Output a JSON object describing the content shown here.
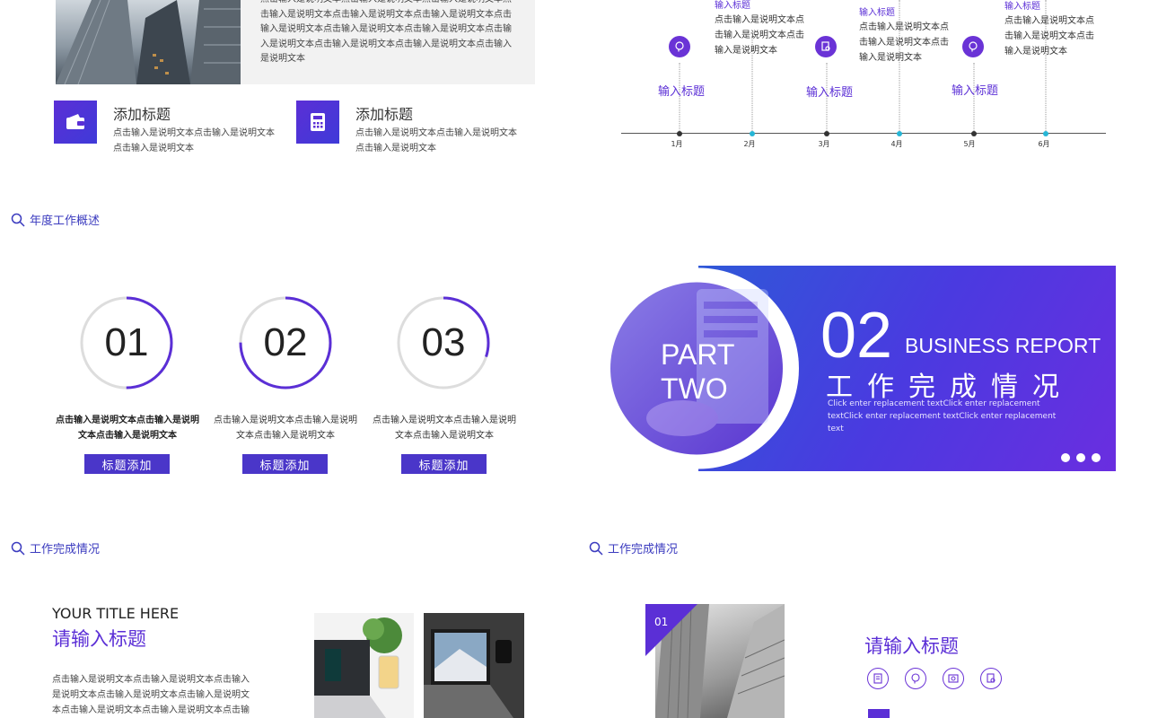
{
  "colors": {
    "accent": "#5b2fd6",
    "ring_track": "#dddddd",
    "banner_start": "#2f58d8",
    "banner_end": "#6a2ee0"
  },
  "slide1": {
    "paragraph": "点击输入是说明文本点击输入是说明文本点击输入是说明文本点击输入是说明文本点击输入是说明文本点击输入是说明文本点击输入是说明文本点击输入是说明文本点击输入是说明文本点击输入是说明文本点击输入是说明文本点击输入是说明文本点击输入是说明文本",
    "features": [
      {
        "title": "添加标题",
        "desc": "点击输入是说明文本点击输入是说明文本点击输入是说明文本",
        "icon": "wallet-icon"
      },
      {
        "title": "添加标题",
        "desc": "点击输入是说明文本点击输入是说明文本点击输入是说明文本",
        "icon": "calculator-icon"
      }
    ]
  },
  "timeline": {
    "months": [
      "1月",
      "2月",
      "3月",
      "4月",
      "5月",
      "6月"
    ],
    "labels": [
      "输入标题",
      "输入标题",
      "输入标题"
    ],
    "infos": [
      {
        "title": "输入标题",
        "desc": "点击输入是说明文本点击输入是说明文本点击输入是说明文本"
      },
      {
        "title": "输入标题",
        "desc": "点击输入是说明文本点击输入是说明文本点击输入是说明文本"
      },
      {
        "title": "输入标题",
        "desc": "点击输入是说明文本点击输入是说明文本点击输入是说明文本"
      }
    ],
    "icons": [
      "head-icon",
      "document-search-icon",
      "head-icon"
    ]
  },
  "sections": {
    "annual": "年度工作概述",
    "done_left": "工作完成情况",
    "done_right": "工作完成情况"
  },
  "rings": [
    {
      "num": "01",
      "text": "点击输入是说明文本点击输入是说明文本点击输入是说明文本",
      "button": "标题添加",
      "progress": 0.5
    },
    {
      "num": "02",
      "text": "点击输入是说明文本点击输入是说明文本点击输入是说明文本",
      "button": "标题添加",
      "progress": 0.75
    },
    {
      "num": "03",
      "text": "点击输入是说明文本点击输入是说明文本点击输入是说明文本",
      "button": "标题添加",
      "progress": 0.3
    }
  ],
  "banner": {
    "part_line1": "PART",
    "part_line2": "TWO",
    "number": "02",
    "eng": "BUSINESS REPORT",
    "cn": "工作完成情况",
    "desc": "Click enter replacement textClick enter replacement textClick enter replacement textClick enter replacement text"
  },
  "slide5": {
    "title_en": "YOUR TITLE HERE",
    "title_cn": "请输入标题",
    "desc": "点击输入是说明文本点击输入是说明文本点击输入是说明文本点击输入是说明文本点击输入是说明文本点击输入是说明文本点击输入是说明文本点击输入是说明文本"
  },
  "slide6": {
    "tag": "01",
    "title": "请输入标题",
    "icons": [
      "document-icon",
      "head-icon",
      "image-icon",
      "search-doc-icon"
    ]
  }
}
